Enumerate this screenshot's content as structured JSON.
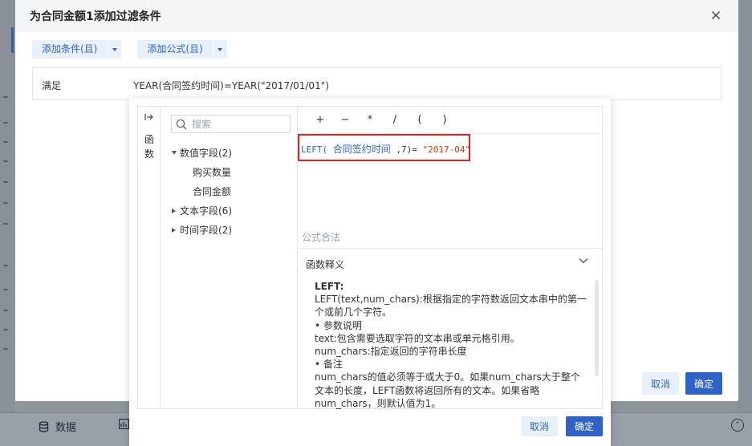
{
  "background": {
    "bottom_tabs": [
      {
        "label": "数据"
      }
    ]
  },
  "dialog": {
    "title": "为合同金额1添加过滤条件",
    "add_condition_label": "添加条件(且)",
    "add_formula_label": "添加公式(且)",
    "condition": {
      "label": "满足",
      "value": "YEAR(合同签约时间)=YEAR(\"2017/01/01\")"
    },
    "cancel_label": "取消",
    "ok_label": "确定"
  },
  "formula_popup": {
    "function_tab_label": "函数",
    "search_placeholder": "搜索",
    "tree": [
      {
        "label": "数值字段(2)",
        "expanded": true,
        "children": [
          {
            "label": "购买数量"
          },
          {
            "label": "合同金额"
          }
        ]
      },
      {
        "label": "文本字段(6)",
        "expanded": false
      },
      {
        "label": "时间字段(2)",
        "expanded": false
      }
    ],
    "operators": [
      "+",
      "−",
      "*",
      "/",
      "(",
      ")"
    ],
    "formula": {
      "func": "LEFT(",
      "field": "合同签约时间",
      "rest": ",7)=",
      "string": "\"2017-04\""
    },
    "validity_text": "公式合法",
    "description_title": "函数释义",
    "description_lines": [
      "LEFT:",
      "LEFT(text,num_chars):根据指定的字符数返回文本串中的第一个或前几个字符。",
      "• 参数说明",
      "text:包含需要选取字符的文本串或单元格引用。",
      "num_chars:指定返回的字符串长度",
      "• 备注",
      "num_chars的值必须等于或大于0。如果num_chars大于整个文本的长度，LEFT函数将返回所有的文本。如果省略num_chars，则默认值为1。"
    ],
    "cancel_label": "取消",
    "ok_label": "确定"
  }
}
